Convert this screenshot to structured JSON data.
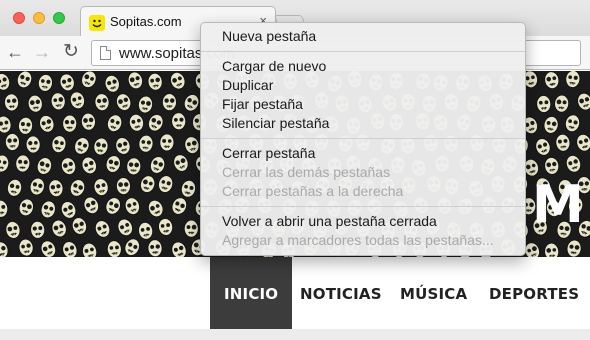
{
  "window": {
    "tab": {
      "title": "Sopitas.com",
      "close_label": "×"
    },
    "url": "www.sopitas.com"
  },
  "toolbar": {
    "back_icon": "←",
    "forward_icon": "→",
    "reload_icon": "↻"
  },
  "banner": {
    "brand_letter": "M"
  },
  "nav": {
    "items": [
      {
        "label": "INICIO"
      },
      {
        "label": "NOTICIAS"
      },
      {
        "label": "MÚSICA"
      },
      {
        "label": "DEPORTES"
      }
    ]
  },
  "context_menu": {
    "items": [
      {
        "label": "Nueva pestaña",
        "enabled": true
      },
      {
        "label": "Cargar de nuevo",
        "enabled": true
      },
      {
        "label": "Duplicar",
        "enabled": true
      },
      {
        "label": "Fijar pestaña",
        "enabled": true
      },
      {
        "label": "Silenciar pestaña",
        "enabled": true
      },
      {
        "label": "Cerrar pestaña",
        "enabled": true
      },
      {
        "label": "Cerrar las demás pestañas",
        "enabled": false
      },
      {
        "label": "Cerrar pestañas a la derecha",
        "enabled": false
      },
      {
        "label": "Volver a abrir una pestaña cerrada",
        "enabled": true
      },
      {
        "label": "Agregar a marcadores todas las pestañas...",
        "enabled": false
      }
    ]
  },
  "colors": {
    "banner_bg": "#1b1b1b",
    "skull": "#e9e6c9",
    "nav_active_bg": "#3c3c3c",
    "favicon_yellow": "#f7e600"
  }
}
